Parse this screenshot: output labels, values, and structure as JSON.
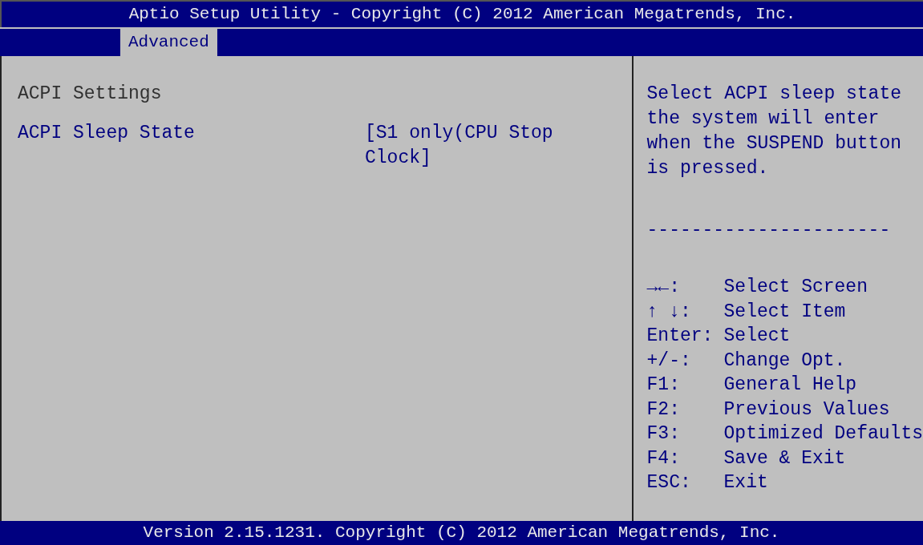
{
  "window": {
    "title": "Aptio Setup Utility - Copyright (C) 2012 American Megatrends, Inc."
  },
  "tabs": [
    {
      "label": "Advanced",
      "selected": true
    }
  ],
  "items": [
    {
      "kind": "heading",
      "label": "ACPI Settings"
    },
    {
      "kind": "setting",
      "label": "ACPI Sleep State",
      "value": "[S1 only(CPU Stop Clock]"
    }
  ],
  "help": {
    "text": "Select ACPI sleep state the system will enter when the SUSPEND button is pressed.",
    "separator": "----------------------"
  },
  "keys": [
    {
      "key": "→←:",
      "action": "Select Screen"
    },
    {
      "key": "↑ ↓:",
      "action": "Select Item"
    },
    {
      "key": "Enter:",
      "action": "Select"
    },
    {
      "key": "+/-:",
      "action": "Change Opt."
    },
    {
      "key": "F1:",
      "action": "General Help"
    },
    {
      "key": "F2:",
      "action": "Previous Values"
    },
    {
      "key": "F3:",
      "action": "Optimized Defaults"
    },
    {
      "key": "F4:",
      "action": "Save & Exit"
    },
    {
      "key": "ESC:",
      "action": "Exit"
    }
  ],
  "status_bar": {
    "text": "Version 2.15.1231. Copyright (C) 2012 American Megatrends, Inc."
  }
}
